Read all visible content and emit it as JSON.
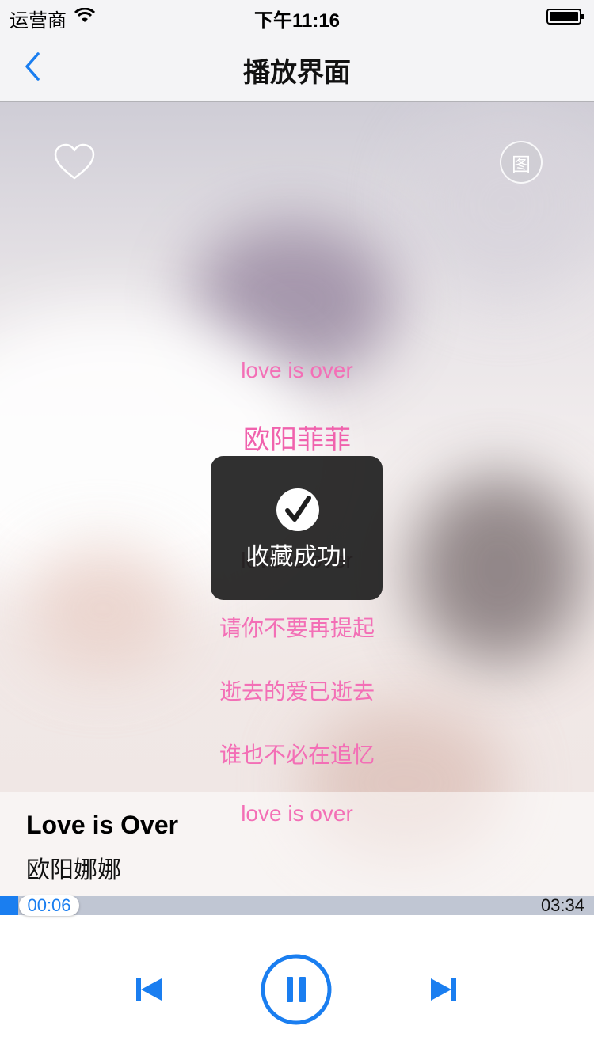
{
  "status_bar": {
    "carrier": "运营商",
    "time": "下午11:16"
  },
  "nav": {
    "title": "播放界面"
  },
  "top_actions": {
    "image_button_label": "图"
  },
  "lyrics": [
    {
      "text": "love is over",
      "style": "normal"
    },
    {
      "text": "欧阳菲菲",
      "style": "current"
    },
    {
      "text": "love is over",
      "style": "dim"
    },
    {
      "text": "请你不要再提起",
      "style": "normal"
    },
    {
      "text": "逝去的爱已逝去",
      "style": "normal"
    },
    {
      "text": "谁也不必在追忆",
      "style": "normal"
    },
    {
      "text": "love is over",
      "style": "normal"
    }
  ],
  "song": {
    "title": "Love is Over",
    "artist": "欧阳娜娜"
  },
  "progress": {
    "current_time": "00:06",
    "duration": "03:34",
    "fraction": 0.03
  },
  "toast": {
    "message": "收藏成功!"
  },
  "colors": {
    "accent": "#1a7ef0",
    "lyric_pink": "#f36fb6",
    "toast_bg": "#1e1e1e"
  },
  "icons": {
    "back": "chevron-left-icon",
    "favorite": "heart-outline-icon",
    "image": "image-icon",
    "prev": "skip-previous-icon",
    "play_pause": "pause-icon",
    "next": "skip-next-icon",
    "toast": "checkmark-icon"
  }
}
